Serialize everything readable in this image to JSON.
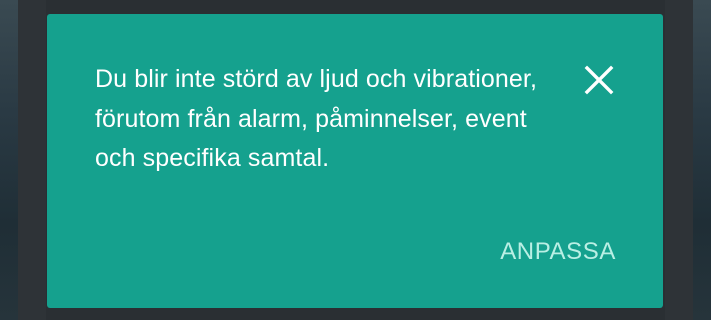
{
  "notification": {
    "message": "Du blir inte störd av ljud och vibrationer, förutom från alarm, påminnelser, event och specifika samtal.",
    "close_icon": "close-icon",
    "action_label": "ANPASSA"
  },
  "colors": {
    "card_background": "#15a18e",
    "message_text": "#ffffff",
    "action_text": "#b9efe4",
    "screen_background": "#2a2f33"
  }
}
